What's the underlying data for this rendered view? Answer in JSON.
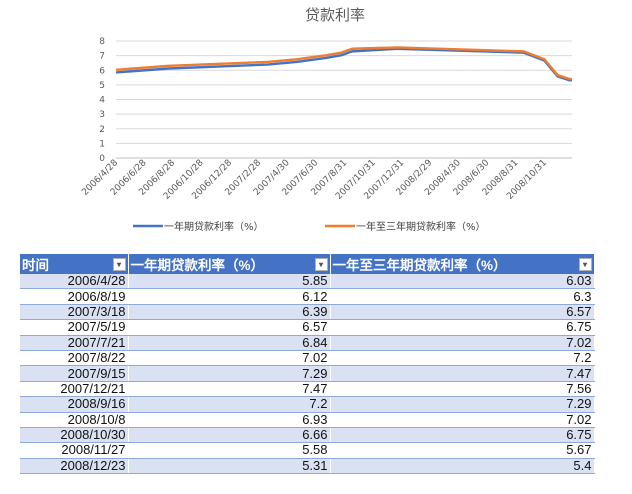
{
  "chart_data": {
    "type": "line",
    "title": "贷款利率",
    "x": [
      "2006/4/28",
      "2006/8/19",
      "2007/3/18",
      "2007/5/19",
      "2007/7/21",
      "2007/8/22",
      "2007/9/15",
      "2007/12/21",
      "2008/9/16",
      "2008/10/8",
      "2008/10/30",
      "2008/11/27",
      "2008/12/23"
    ],
    "x_dates": [
      "2006-04-28",
      "2006-08-19",
      "2007-03-18",
      "2007-05-19",
      "2007-07-21",
      "2007-08-22",
      "2007-09-15",
      "2007-12-21",
      "2008-09-16",
      "2008-10-08",
      "2008-10-30",
      "2008-11-27",
      "2008-12-23"
    ],
    "series": [
      {
        "name": "一年期贷款利率（%）",
        "values": [
          5.85,
          6.12,
          6.39,
          6.57,
          6.84,
          7.02,
          7.29,
          7.47,
          7.2,
          6.93,
          6.66,
          5.58,
          5.31
        ],
        "color": "#4472c4"
      },
      {
        "name": "一年至三年期贷款利率（%）",
        "values": [
          6.03,
          6.3,
          6.57,
          6.75,
          7.02,
          7.2,
          7.47,
          7.56,
          7.29,
          7.02,
          6.75,
          5.67,
          5.4
        ],
        "color": "#ed7d31"
      }
    ],
    "xtick_labels": [
      "2006/4/28",
      "2006/6/28",
      "2006/8/28",
      "2006/10/28",
      "2006/12/28",
      "2007/2/28",
      "2007/4/30",
      "2007/6/30",
      "2007/8/31",
      "2007/10/31",
      "2007/12/31",
      "2008/2/29",
      "2008/4/30",
      "2008/6/30",
      "2008/8/31",
      "2008/10/31"
    ],
    "xtick_dates": [
      "2006-04-28",
      "2006-06-28",
      "2006-08-28",
      "2006-10-28",
      "2006-12-28",
      "2007-02-28",
      "2007-04-30",
      "2007-06-30",
      "2007-08-31",
      "2007-10-31",
      "2007-12-31",
      "2008-02-29",
      "2008-04-30",
      "2008-06-30",
      "2008-08-31",
      "2008-10-31"
    ],
    "xlim": [
      "2006-04-28",
      "2008-12-28"
    ],
    "yticks": [
      0,
      1,
      2,
      3,
      4,
      5,
      6,
      7,
      8
    ],
    "ylim": [
      0,
      8
    ],
    "grid": true,
    "legend": "bottom"
  },
  "table": {
    "headers": [
      "时间",
      "一年期贷款利率（%）",
      "一年至三年期贷款利率（%）"
    ],
    "filter_icon": "▾",
    "rows": [
      [
        "2006/4/28",
        "5.85",
        "6.03"
      ],
      [
        "2006/8/19",
        "6.12",
        "6.3"
      ],
      [
        "2007/3/18",
        "6.39",
        "6.57"
      ],
      [
        "2007/5/19",
        "6.57",
        "6.75"
      ],
      [
        "2007/7/21",
        "6.84",
        "7.02"
      ],
      [
        "2007/8/22",
        "7.02",
        "7.2"
      ],
      [
        "2007/9/15",
        "7.29",
        "7.47"
      ],
      [
        "2007/12/21",
        "7.47",
        "7.56"
      ],
      [
        "2008/9/16",
        "7.2",
        "7.29"
      ],
      [
        "2008/10/8",
        "6.93",
        "7.02"
      ],
      [
        "2008/10/30",
        "6.66",
        "6.75"
      ],
      [
        "2008/11/27",
        "5.58",
        "5.67"
      ],
      [
        "2008/12/23",
        "5.31",
        "5.4"
      ]
    ]
  }
}
